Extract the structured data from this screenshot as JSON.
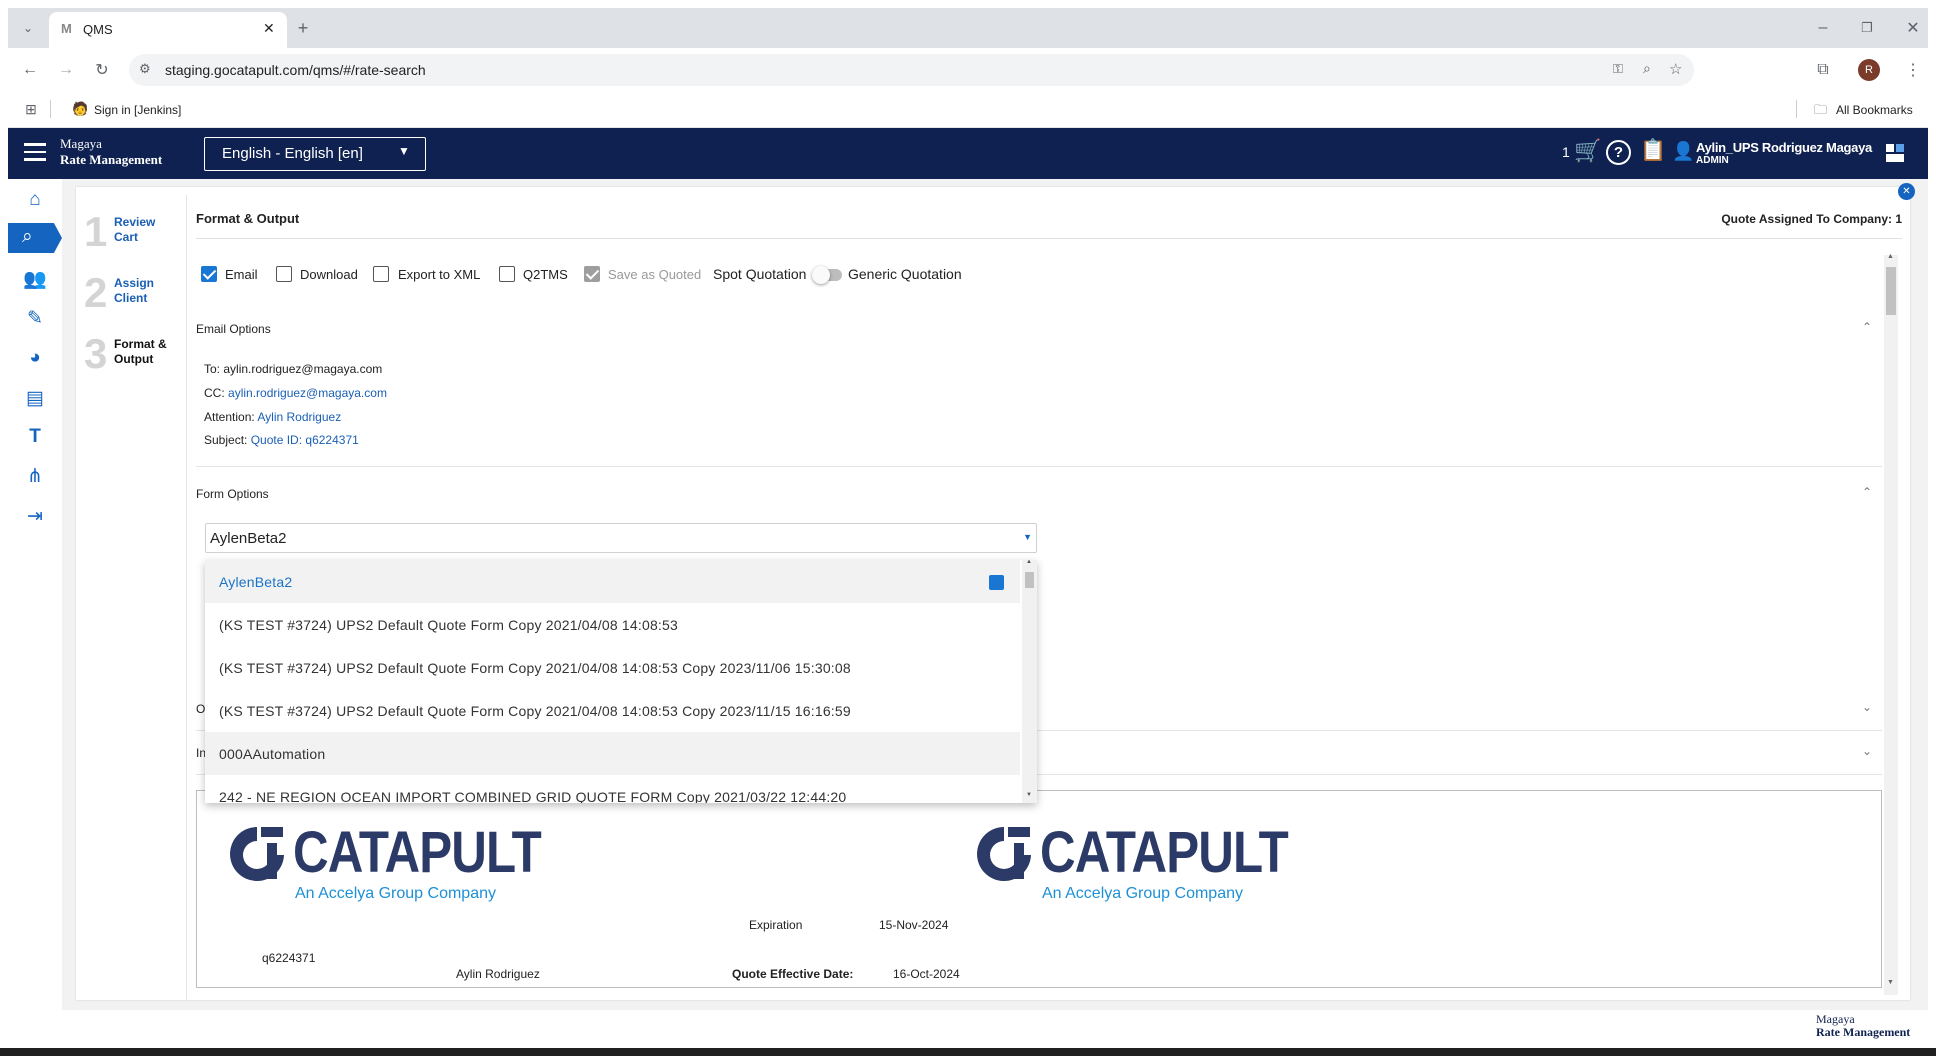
{
  "browser": {
    "tab_title": "QMS",
    "url": "staging.gocatapult.com/qms/#/rate-search",
    "bookmark_1": "Sign in [Jenkins]",
    "all_bookmarks": "All Bookmarks",
    "profile_initial": "R"
  },
  "header": {
    "brand_line1": "Magaya",
    "brand_line2": "Rate Management",
    "language": "English - English [en]",
    "cart_count": "1",
    "user_name": "Aylin_UPS Rodriguez Magaya",
    "user_role": "ADMIN"
  },
  "steps": [
    {
      "num": "1",
      "label_line1": "Review",
      "label_line2": "Cart"
    },
    {
      "num": "2",
      "label_line1": "Assign",
      "label_line2": "Client"
    },
    {
      "num": "3",
      "label_line1": "Format &",
      "label_line2": "Output"
    }
  ],
  "main": {
    "title": "Format & Output",
    "quote_assigned": "Quote Assigned To Company: 1",
    "options": {
      "email": "Email",
      "download": "Download",
      "export_xml": "Export to XML",
      "q2tms": "Q2TMS",
      "save_as_quoted": "Save as Quoted",
      "spot_quotation": "Spot Quotation",
      "generic_quotation": "Generic Quotation"
    },
    "email_options": {
      "title": "Email Options",
      "to_label": "To:",
      "to_value": "aylin.rodriguez@magaya.com",
      "cc_label": "CC:",
      "cc_value": "aylin.rodriguez@magaya.com",
      "attention_label": "Attention:",
      "attention_value": "Aylin Rodriguez",
      "subject_label": "Subject:",
      "subject_value": "Quote ID: q6224371"
    },
    "form_options": {
      "title": "Form Options",
      "selected": "AylenBeta2",
      "items": [
        "AylenBeta2",
        "(KS TEST #3724) UPS2 Default Quote Form Copy 2021/04/08 14:08:53",
        "(KS TEST #3724) UPS2 Default Quote Form Copy 2021/04/08 14:08:53 Copy 2023/11/06 15:30:08",
        "(KS TEST #3724) UPS2 Default Quote Form Copy 2021/04/08 14:08:53 Copy 2023/11/15 16:16:59",
        "000AAutomation",
        "242 - NE REGION OCEAN IMPORT COMBINED GRID QUOTE FORM Copy 2021/03/22 12:44:20"
      ]
    },
    "collapsed_1": "O",
    "collapsed_2": "In"
  },
  "preview": {
    "logo_word": "CATAPULT",
    "logo_sub": "An Accelya Group Company",
    "expiration_label": "Expiration",
    "expiration_value": "15-Nov-2024",
    "quote_id": "q6224371",
    "contact": "Aylin Rodriguez",
    "effective_label": "Quote Effective Date:",
    "effective_value": "16-Oct-2024"
  },
  "footer": {
    "line1": "Magaya",
    "line2": "Rate Management"
  },
  "colors": {
    "header_bg": "#0f2150",
    "accent": "#1976d2",
    "link": "#1a5fb4"
  }
}
